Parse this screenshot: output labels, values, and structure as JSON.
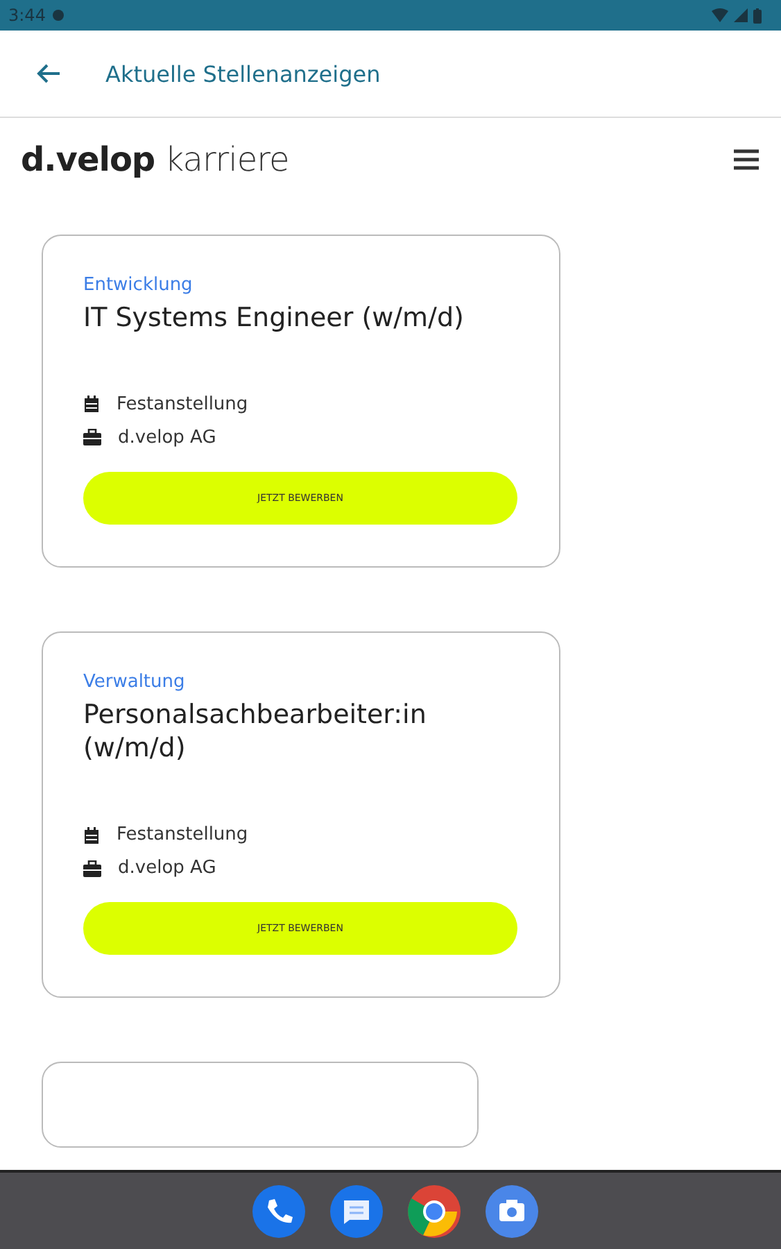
{
  "status_bar": {
    "time": "3:44"
  },
  "app_bar": {
    "title": "Aktuelle Stellenanzeigen"
  },
  "logo": {
    "brand": "d.velop",
    "suffix": "karriere"
  },
  "jobs": [
    {
      "category": "Entwicklung",
      "title": "IT Systems Engineer (w/m/d)",
      "meta": [
        {
          "kind": "employment",
          "text": "Festanstellung"
        },
        {
          "kind": "company",
          "text": "d.velop AG"
        }
      ],
      "button": "JETZT BEWERBEN"
    },
    {
      "category": "Verwaltung",
      "title": "Personalsachbearbeiter:in (w/m/d)",
      "meta": [
        {
          "kind": "employment",
          "text": "Festanstellung"
        },
        {
          "kind": "company",
          "text": "d.velop AG"
        }
      ],
      "button": "JETZT BEWERBEN"
    },
    {
      "kind": "partial"
    }
  ],
  "dock": [
    {
      "kind": "phone"
    },
    {
      "kind": "messages"
    },
    {
      "kind": "browser"
    },
    {
      "kind": "camera"
    }
  ]
}
